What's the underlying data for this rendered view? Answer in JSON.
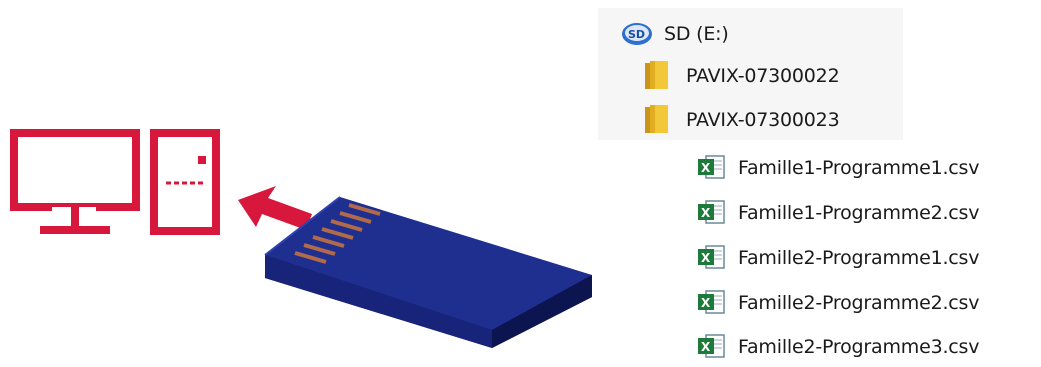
{
  "colors": {
    "computer": "#d8173d",
    "arrow": "#d8173d",
    "card_body": "#1f2f8f",
    "card_contacts": "#b36a4a",
    "folder": "#e6b722",
    "csv_icon": "#1e7a3a"
  },
  "illustration": {
    "computer_icon": "desktop-computer-icon",
    "arrow_icon": "arrow-up-left-icon",
    "card_icon": "sd-card-icon"
  },
  "explorer": {
    "drive": {
      "icon": "sd-drive-icon",
      "label": "SD (E:)"
    },
    "folders": [
      {
        "icon": "folder-icon",
        "label": "PAVIX-07300022"
      },
      {
        "icon": "folder-icon",
        "label": "PAVIX-07300023"
      }
    ],
    "files": [
      {
        "icon": "csv-file-icon",
        "label": "Famille1-Programme1.csv"
      },
      {
        "icon": "csv-file-icon",
        "label": "Famille1-Programme2.csv"
      },
      {
        "icon": "csv-file-icon",
        "label": "Famille2-Programme1.csv"
      },
      {
        "icon": "csv-file-icon",
        "label": "Famille2-Programme2.csv"
      },
      {
        "icon": "csv-file-icon",
        "label": "Famille2-Programme3.csv"
      }
    ]
  }
}
